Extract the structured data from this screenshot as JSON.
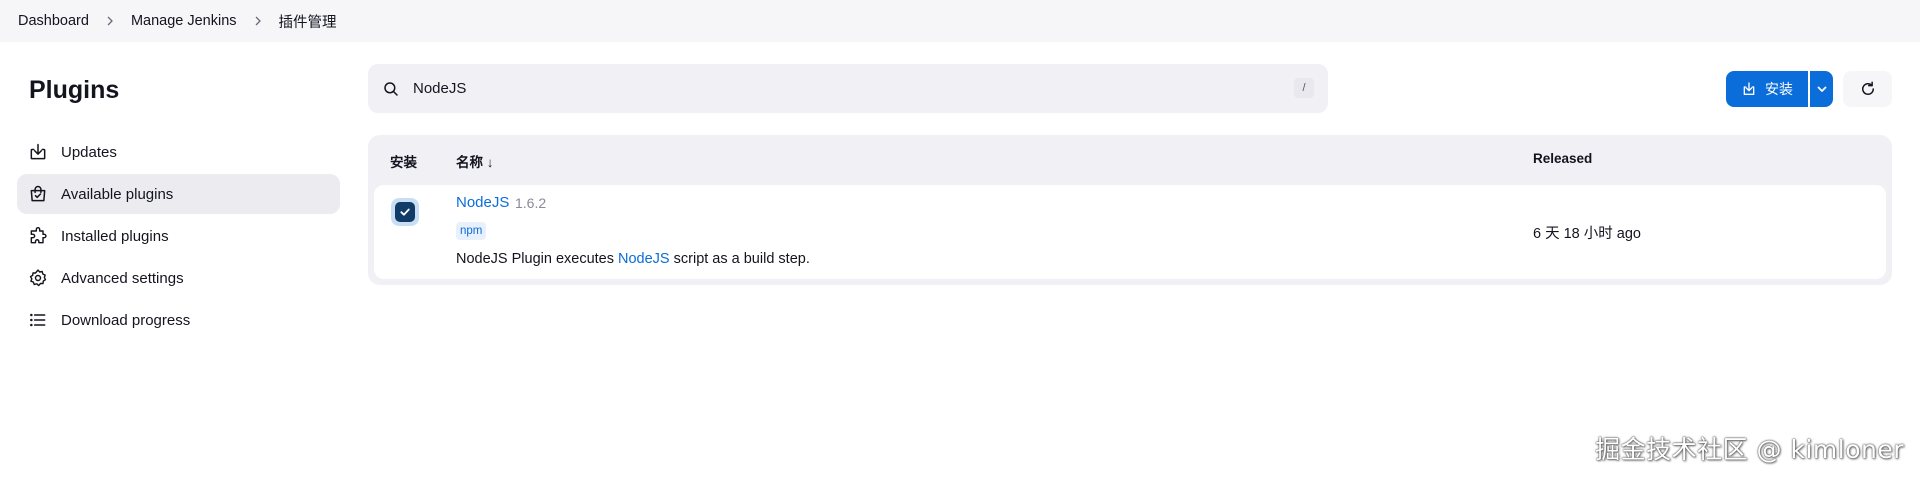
{
  "breadcrumb": [
    "Dashboard",
    "Manage Jenkins",
    "插件管理"
  ],
  "sidebar": {
    "title": "Plugins",
    "items": [
      {
        "label": "Updates",
        "icon": "download-icon",
        "active": false
      },
      {
        "label": "Available plugins",
        "icon": "shopping-bag-icon",
        "active": true
      },
      {
        "label": "Installed plugins",
        "icon": "puzzle-icon",
        "active": false
      },
      {
        "label": "Advanced settings",
        "icon": "gear-icon",
        "active": false
      },
      {
        "label": "Download progress",
        "icon": "list-icon",
        "active": false
      }
    ]
  },
  "search": {
    "value": "NodeJS",
    "shortcut": "/",
    "icon": "search-icon"
  },
  "toolbar": {
    "install_label": "安装",
    "install_icon": "download-icon",
    "refresh_icon": "refresh-icon"
  },
  "table": {
    "headers": {
      "install": "安装",
      "name": "名称 ↓",
      "released": "Released"
    },
    "rows": [
      {
        "checked": true,
        "name": "NodeJS",
        "version": "1.6.2",
        "tag": "npm",
        "desc_prefix": "NodeJS Plugin executes ",
        "desc_link": "NodeJS",
        "desc_suffix": " script as a build step.",
        "released": "6 天 18 小时 ago"
      }
    ]
  },
  "watermark": "掘金技术社区 @ kimloner",
  "colors": {
    "accent": "#0b6dd9",
    "checkbox": "#0f3b66",
    "sidebar_active": "#ebebf0"
  }
}
